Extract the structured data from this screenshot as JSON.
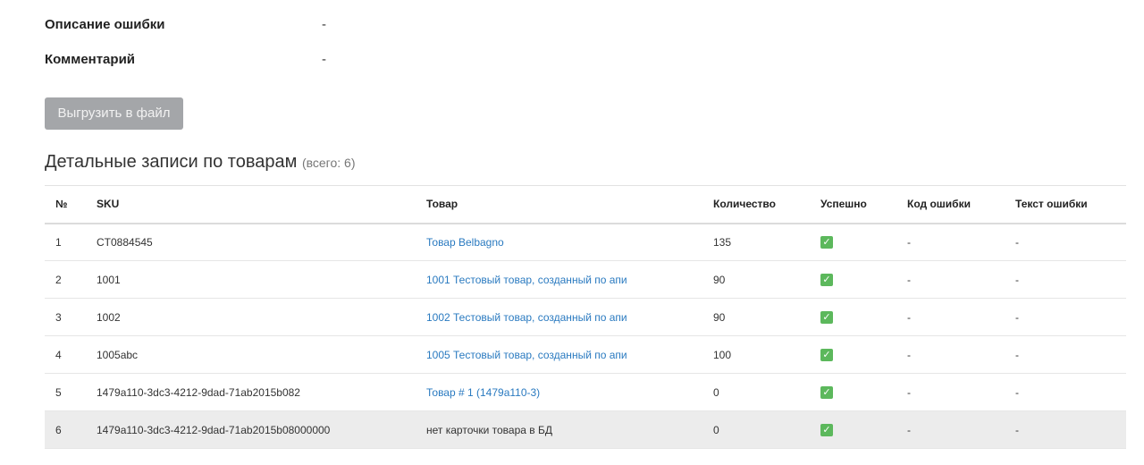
{
  "info": {
    "error_description_label": "Описание ошибки",
    "error_description_value": "-",
    "comment_label": "Комментарий",
    "comment_value": "-"
  },
  "export_button_label": "Выгрузить в файл",
  "section": {
    "title": "Детальные записи по товарам",
    "count": "(всего: 6)"
  },
  "table": {
    "headers": {
      "no": "№",
      "sku": "SKU",
      "product": "Товар",
      "quantity": "Количество",
      "success": "Успешно",
      "error_code": "Код ошибки",
      "error_text": "Текст ошибки"
    },
    "rows": [
      {
        "no": "1",
        "sku": "CT0884545",
        "product": "Товар Belbagno",
        "quantity": "135",
        "error_code": "-",
        "error_text": "-"
      },
      {
        "no": "2",
        "sku": "1001",
        "product": "1001 Тестовый товар, созданный по апи",
        "quantity": "90",
        "error_code": "-",
        "error_text": "-"
      },
      {
        "no": "3",
        "sku": "1002",
        "product": "1002 Тестовый товар, созданный по апи",
        "quantity": "90",
        "error_code": "-",
        "error_text": "-"
      },
      {
        "no": "4",
        "sku": "1005abc",
        "product": "1005 Тестовый товар, созданный по апи",
        "quantity": "100",
        "error_code": "-",
        "error_text": "-"
      },
      {
        "no": "5",
        "sku": "1479a110-3dc3-4212-9dad-71ab2015b082",
        "product": "Товар # 1 (1479a110-3)",
        "quantity": "0",
        "error_code": "-",
        "error_text": "-"
      },
      {
        "no": "6",
        "sku": "1479a110-3dc3-4212-9dad-71ab2015b08000000",
        "product": "нет карточки товара в БД",
        "quantity": "0",
        "error_code": "-",
        "error_text": "-"
      }
    ],
    "success_icon": "check-square-icon",
    "success_color": "#5cb85c",
    "link_color": "#2a7ac0"
  }
}
